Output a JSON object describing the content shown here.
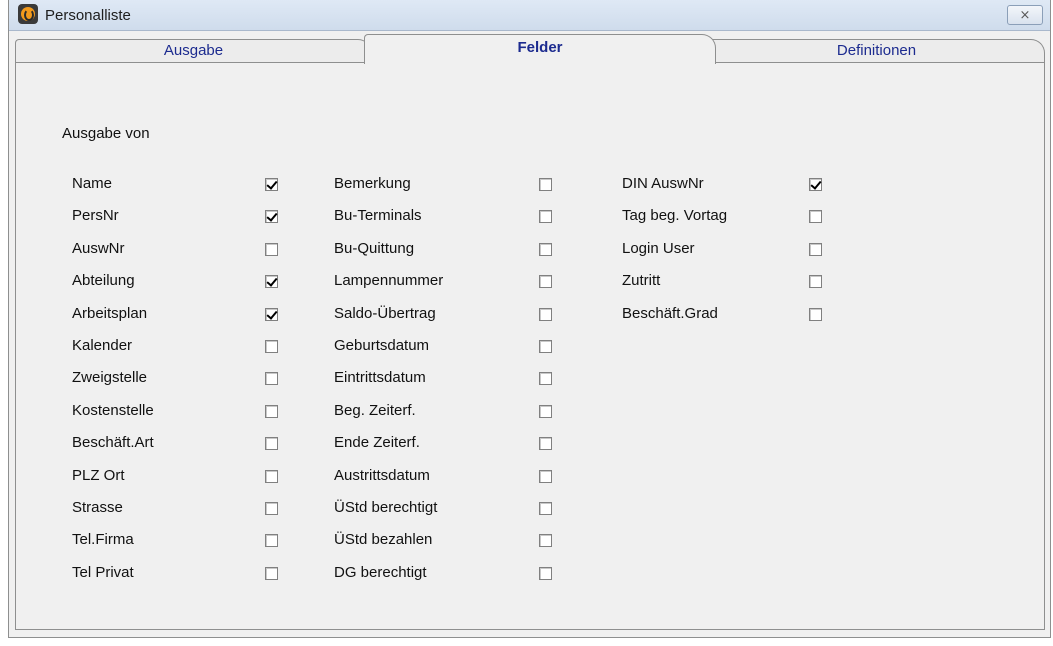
{
  "window": {
    "title": "Personalliste",
    "close_glyph": "⨯"
  },
  "tabs": [
    {
      "label": "Ausgabe",
      "active": false
    },
    {
      "label": "Felder",
      "active": true
    },
    {
      "label": "Definitionen",
      "active": false
    }
  ],
  "section": {
    "label": "Ausgabe von"
  },
  "columns": [
    [
      {
        "label": "Name",
        "checked": true
      },
      {
        "label": "PersNr",
        "checked": true
      },
      {
        "label": "AuswNr",
        "checked": false
      },
      {
        "label": "Abteilung",
        "checked": true
      },
      {
        "label": "Arbeitsplan",
        "checked": true
      },
      {
        "label": "Kalender",
        "checked": false
      },
      {
        "label": "Zweigstelle",
        "checked": false
      },
      {
        "label": "Kostenstelle",
        "checked": false
      },
      {
        "label": "Beschäft.Art",
        "checked": false
      },
      {
        "label": "PLZ Ort",
        "checked": false
      },
      {
        "label": "Strasse",
        "checked": false
      },
      {
        "label": "Tel.Firma",
        "checked": false
      },
      {
        "label": "Tel Privat",
        "checked": false
      }
    ],
    [
      {
        "label": "Bemerkung",
        "checked": false
      },
      {
        "label": "Bu-Terminals",
        "checked": false
      },
      {
        "label": "Bu-Quittung",
        "checked": false
      },
      {
        "label": "Lampennummer",
        "checked": false
      },
      {
        "label": "Saldo-Übertrag",
        "checked": false
      },
      {
        "label": "Geburtsdatum",
        "checked": false
      },
      {
        "label": "Eintrittsdatum",
        "checked": false
      },
      {
        "label": "Beg. Zeiterf.",
        "checked": false
      },
      {
        "label": "Ende Zeiterf.",
        "checked": false
      },
      {
        "label": "Austrittsdatum",
        "checked": false
      },
      {
        "label": "ÜStd berechtigt",
        "checked": false
      },
      {
        "label": "ÜStd bezahlen",
        "checked": false
      },
      {
        "label": "DG berechtigt",
        "checked": false
      }
    ],
    [
      {
        "label": "DIN AuswNr",
        "checked": true
      },
      {
        "label": "Tag beg. Vortag",
        "checked": false
      },
      {
        "label": "Login User",
        "checked": false
      },
      {
        "label": "Zutritt",
        "checked": false
      },
      {
        "label": "Beschäft.Grad",
        "checked": false
      }
    ]
  ],
  "colors": {
    "tab_text": "#1c2b8f",
    "window_bg": "#f0f0f0"
  }
}
